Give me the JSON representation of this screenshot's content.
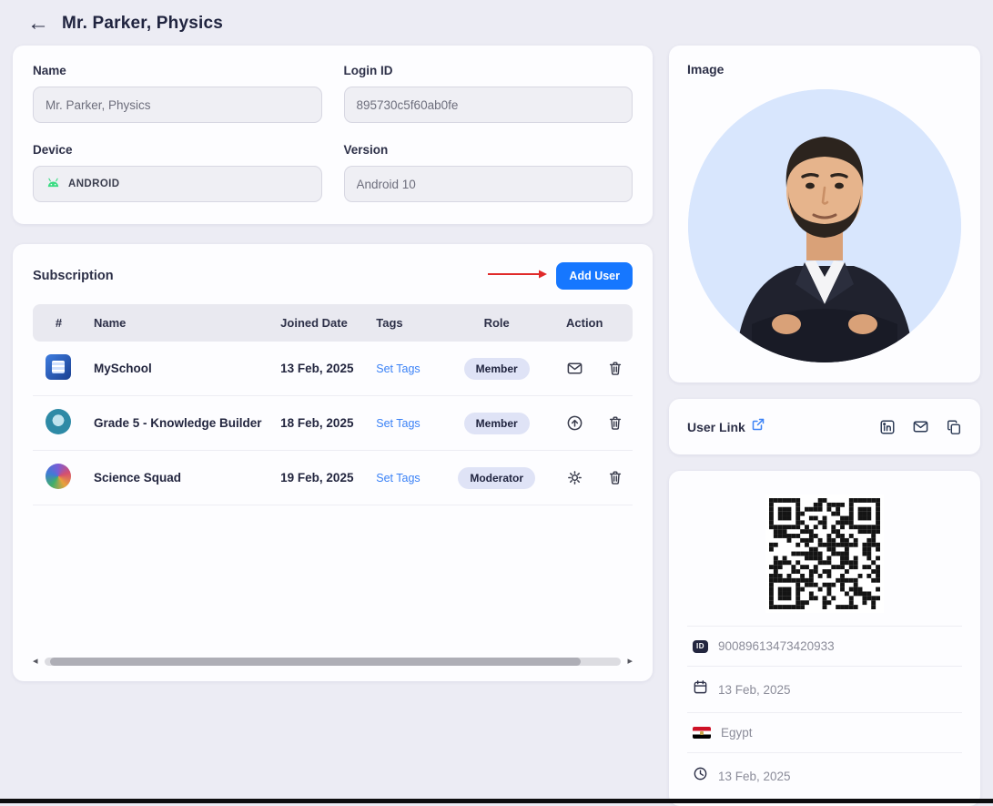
{
  "header": {
    "back_glyph": "←",
    "title": "Mr. Parker, Physics"
  },
  "details": {
    "name_label": "Name",
    "name_value": "Mr. Parker, Physics",
    "login_label": "Login ID",
    "login_value": "895730c5f60ab0fe",
    "device_label": "Device",
    "device_value": "ANDROID",
    "version_label": "Version",
    "version_value": "Android 10"
  },
  "subscription": {
    "title": "Subscription",
    "add_user_label": "Add User",
    "columns": {
      "num": "#",
      "name": "Name",
      "joined": "Joined Date",
      "tags": "Tags",
      "role": "Role",
      "action": "Action"
    },
    "rows": [
      {
        "name": "MySchool",
        "joined": "13 Feb, 2025",
        "tags": "Set Tags",
        "role": "Member",
        "action_icon": "mail-icon"
      },
      {
        "name": "Grade 5 - Knowledge Builder",
        "joined": "18 Feb, 2025",
        "tags": "Set Tags",
        "role": "Member",
        "action_icon": "arrow-up-circle-icon"
      },
      {
        "name": "Science Squad",
        "joined": "19 Feb, 2025",
        "tags": "Set Tags",
        "role": "Moderator",
        "action_icon": "gear-icon"
      }
    ],
    "scroll_left_glyph": "◂",
    "scroll_right_glyph": "▸"
  },
  "sidebar": {
    "image_title": "Image",
    "user_link_title": "User Link",
    "qr_id": "90089613473420933",
    "joined_date": "13 Feb, 2025",
    "country": "Egypt",
    "updated_date": "13 Feb, 2025",
    "id_chip_label": "ID"
  },
  "colors": {
    "accent_blue": "#1677ff",
    "badge_bg": "#dfe3f6",
    "link_blue": "#3b82f6",
    "arrow_red": "#e02a2a",
    "page_bg": "#ececf4"
  }
}
